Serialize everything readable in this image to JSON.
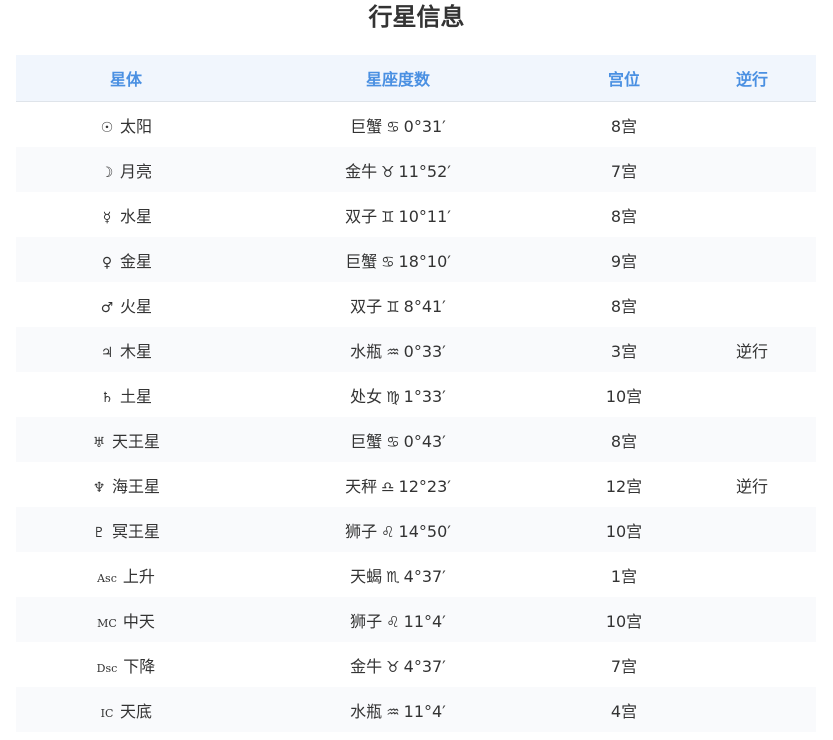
{
  "title": "行星信息",
  "table": {
    "headers": {
      "body": "星体",
      "sign_degree": "星座度数",
      "house": "宫位",
      "retrograde": "逆行"
    },
    "rows": [
      {
        "symbol": "☉",
        "name": "太阳",
        "sign": "巨蟹",
        "sign_symbol": "♋",
        "degree": "0°31′",
        "house": "8宫",
        "retrograde": ""
      },
      {
        "symbol": "☽",
        "name": "月亮",
        "sign": "金牛",
        "sign_symbol": "♉",
        "degree": "11°52′",
        "house": "7宫",
        "retrograde": ""
      },
      {
        "symbol": "☿",
        "name": "水星",
        "sign": "双子",
        "sign_symbol": "♊",
        "degree": "10°11′",
        "house": "8宫",
        "retrograde": ""
      },
      {
        "symbol": "♀",
        "name": "金星",
        "sign": "巨蟹",
        "sign_symbol": "♋",
        "degree": "18°10′",
        "house": "9宫",
        "retrograde": ""
      },
      {
        "symbol": "♂",
        "name": "火星",
        "sign": "双子",
        "sign_symbol": "♊",
        "degree": "8°41′",
        "house": "8宫",
        "retrograde": ""
      },
      {
        "symbol": "♃",
        "name": "木星",
        "sign": "水瓶",
        "sign_symbol": "♒",
        "degree": "0°33′",
        "house": "3宫",
        "retrograde": "逆行"
      },
      {
        "symbol": "♄",
        "name": "土星",
        "sign": "处女",
        "sign_symbol": "♍",
        "degree": "1°33′",
        "house": "10宫",
        "retrograde": ""
      },
      {
        "symbol": "♅",
        "name": "天王星",
        "sign": "巨蟹",
        "sign_symbol": "♋",
        "degree": "0°43′",
        "house": "8宫",
        "retrograde": ""
      },
      {
        "symbol": "♆",
        "name": "海王星",
        "sign": "天秤",
        "sign_symbol": "♎",
        "degree": "12°23′",
        "house": "12宫",
        "retrograde": "逆行"
      },
      {
        "symbol": "♇",
        "name": "冥王星",
        "sign": "狮子",
        "sign_symbol": "♌",
        "degree": "14°50′",
        "house": "10宫",
        "retrograde": ""
      },
      {
        "symbol": "Asc",
        "name": "上升",
        "sign": "天蝎",
        "sign_symbol": "♏",
        "degree": "4°37′",
        "house": "1宫",
        "retrograde": ""
      },
      {
        "symbol": "MC",
        "name": "中天",
        "sign": "狮子",
        "sign_symbol": "♌",
        "degree": "11°4′",
        "house": "10宫",
        "retrograde": ""
      },
      {
        "symbol": "Dsc",
        "name": "下降",
        "sign": "金牛",
        "sign_symbol": "♉",
        "degree": "4°37′",
        "house": "7宫",
        "retrograde": ""
      },
      {
        "symbol": "IC",
        "name": "天底",
        "sign": "水瓶",
        "sign_symbol": "♒",
        "degree": "11°4′",
        "house": "4宫",
        "retrograde": ""
      }
    ]
  },
  "colors": {
    "header_text": "#4a90e2",
    "header_background": "#f1f6fd",
    "stripe_background": "#f9fafc",
    "retrograde_text": "#e0584a",
    "title_text": "#333333"
  }
}
